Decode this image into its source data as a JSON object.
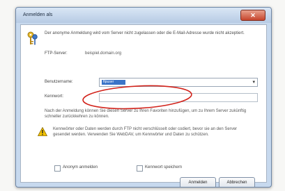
{
  "window": {
    "title": "Anmelden als",
    "close_glyph": "✕"
  },
  "dialog": {
    "intro": "Der anonyme Anmeldung wird vom Server nicht zugelassen oder die E-Mail-Adresse wurde nicht akzeptiert.",
    "ftp_server_label": "FTP-Server:",
    "ftp_server_value": "beispiel.domain.org",
    "username_label": "Benutzername:",
    "username_value": "ftpuser",
    "password_label": "Kennwort:",
    "password_value": "",
    "note": "Nach der Anmeldung können Sie diesen Server zu Ihren Favoriten hinzufügen, um zu Ihrem Server zukünftig schneller zurückkehren zu können.",
    "warning": "Kennwörter oder Daten werden durch FTP nicht verschlüsselt oder codiert, bevor sie an den Server gesendet werden. Verwenden Sie WebDAV, um Kennwörter und Daten zu schützen.",
    "anonymous_label": "Anonym anmelden",
    "save_password_label": "Kennwort speichern",
    "login_button": "Anmelden",
    "cancel_button": "Abbrechen"
  },
  "annotation": {
    "oval_color": "#d2231b"
  },
  "colors": {
    "selection": "#3a74c8",
    "warning": "#f2c200"
  },
  "icons": {
    "dialog": "keys-icon",
    "warning": "warning-icon",
    "close": "close-icon"
  }
}
